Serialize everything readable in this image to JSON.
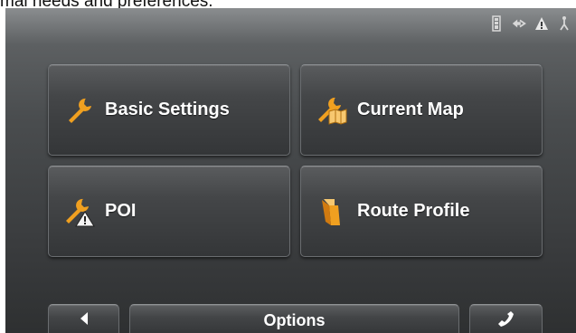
{
  "header_text": "mal needs and preferences.",
  "status_icons": [
    "battery-icon",
    "connection-icon",
    "warning-icon",
    "gps-satellite-icon"
  ],
  "menu": {
    "items": [
      {
        "label": "Basic Settings",
        "icon": "wrench-icon"
      },
      {
        "label": "Current Map",
        "icon": "wrench-map-icon"
      },
      {
        "label": "POI",
        "icon": "wrench-warning-icon"
      },
      {
        "label": "Route Profile",
        "icon": "route-profile-icon"
      }
    ]
  },
  "bottom_bar": {
    "back_icon": "back-arrow-icon",
    "title": "Options",
    "phone_icon": "phone-icon"
  },
  "colors": {
    "accent_orange": "#f0a020",
    "text": "#ffffff"
  }
}
